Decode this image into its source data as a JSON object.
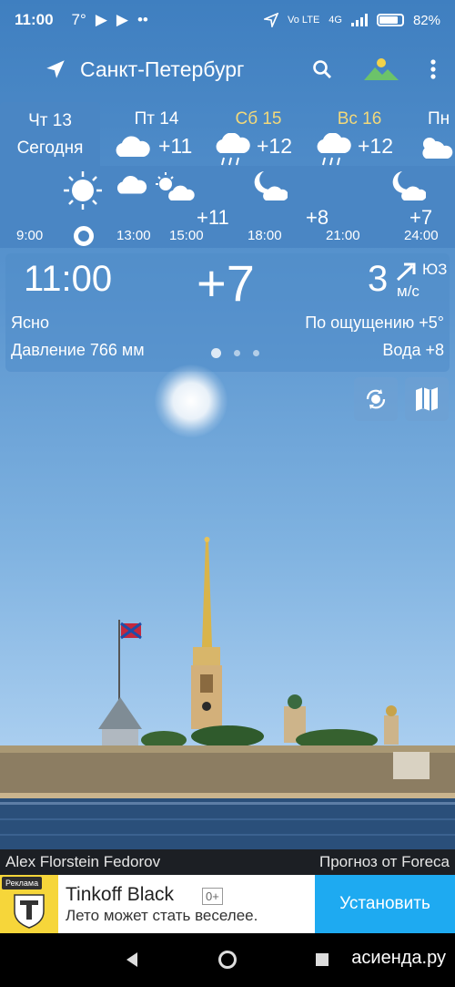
{
  "status_bar": {
    "time": "11:00",
    "temp_indicator": "7°",
    "network": "4G",
    "volte": "Vo LTE",
    "battery": "82%",
    "battery_level": 0.82
  },
  "app_bar": {
    "city": "Санкт-Петербург",
    "icons": [
      "location-arrow-icon",
      "search-icon",
      "landscape-icon",
      "more-vert-icon"
    ]
  },
  "days": [
    {
      "name": "Чт 13",
      "label": "Сегодня",
      "weekend": false
    },
    {
      "name": "Пт 14",
      "temp": "+11",
      "icon": "cloudy-icon",
      "weekend": false
    },
    {
      "name": "Сб 15",
      "temp": "+12",
      "icon": "rain-icon",
      "weekend": true
    },
    {
      "name": "Вс 16",
      "temp": "+12",
      "icon": "rain-icon",
      "weekend": true
    },
    {
      "name": "Пн",
      "icon": "partly-cloudy-icon",
      "weekend": false
    }
  ],
  "hourly": {
    "times": [
      "9:00",
      "13:00",
      "15:00",
      "18:00",
      "21:00",
      "24:00"
    ],
    "temps": [
      "+11",
      "+8",
      "+7"
    ]
  },
  "current": {
    "time": "11:00",
    "temp": "+7",
    "wind_speed": "3",
    "wind_dir": "ЮЗ",
    "wind_unit": "м/с",
    "condition": "Ясно",
    "feels_like": "По ощущению +5°",
    "pressure": "Давление 766 мм",
    "water": "Вода +8"
  },
  "credits": {
    "photo": "Alex Florstein Fedorov",
    "provider": "Прогноз от Foreca"
  },
  "ad": {
    "tag": "Реклама",
    "title": "Tinkoff Black",
    "age": "0+",
    "subtitle": "Лето может стать веселее.",
    "button": "Установить"
  },
  "watermark": "асиенда.ру",
  "colors": {
    "sky_top": "#3f7fc0",
    "panel": "#4a86c4",
    "weekend": "#f3d97a",
    "ad_button": "#1eaaf1"
  }
}
